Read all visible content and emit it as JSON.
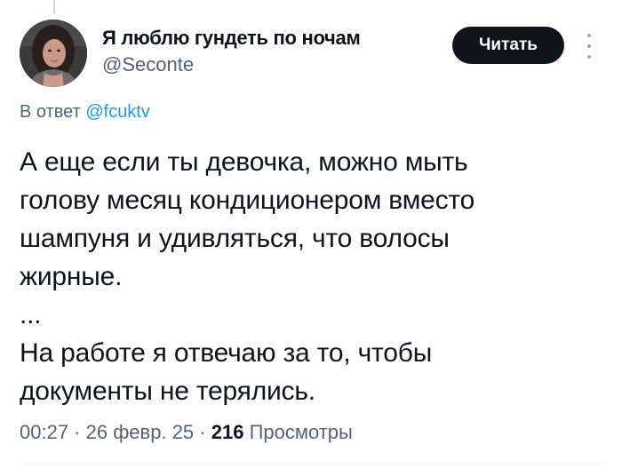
{
  "author": {
    "display_name": "Я люблю гундеть по ночам",
    "handle": "@Seconte",
    "avatar_icon": "user-avatar-photo"
  },
  "follow_button": {
    "label": "Читать"
  },
  "more_icon": "more-options-vertical-dots",
  "reply": {
    "prefix": "В ответ",
    "target": "@fcuktv"
  },
  "tweet": {
    "paragraph_1": "А еще если ты девочка, можно мыть\nголову месяц кондиционером вместо\nшампуня и удивляться, что волосы\nжирные.",
    "ellipsis": "...",
    "paragraph_2": "На работе я отвечаю за то, чтобы\nдокументы не терялись."
  },
  "meta": {
    "time": "00:27",
    "separator_1": " · ",
    "date": "26 февр. 25",
    "separator_2": " · ",
    "views_count": "216",
    "views_label": " Просмотры"
  },
  "colors": {
    "text_primary": "#0f1419",
    "text_secondary": "#536471",
    "link": "#1d9bf0",
    "button_bg": "#0f1419",
    "button_text": "#ffffff"
  }
}
